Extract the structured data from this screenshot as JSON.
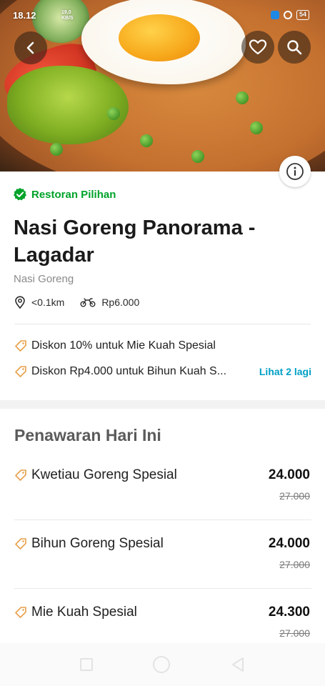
{
  "status_bar": {
    "time": "18.12",
    "net_speed": "19,0",
    "net_unit": "KB/S",
    "battery": "54"
  },
  "hero": {
    "back_icon": "back-arrow-icon",
    "favorite_icon": "heart-icon",
    "search_icon": "search-icon",
    "info_icon": "info-icon"
  },
  "restaurant": {
    "badge": "Restoran Pilihan",
    "name": "Nasi Goreng Panorama - Lagadar",
    "category": "Nasi Goreng",
    "distance": "<0.1km",
    "delivery_fee": "Rp6.000"
  },
  "promos": [
    {
      "text": "Diskon 10% untuk Mie Kuah Spesial"
    },
    {
      "text": "Diskon Rp4.000 untuk Bihun Kuah S..."
    }
  ],
  "promos_more": "Lihat 2 lagi",
  "offers": {
    "title": "Penawaran Hari Ini",
    "items": [
      {
        "name": "Kwetiau Goreng Spesial",
        "price": "24.000",
        "old_price": "27.000"
      },
      {
        "name": "Bihun Goreng Spesial",
        "price": "24.000",
        "old_price": "27.000"
      },
      {
        "name": "Mie Kuah Spesial",
        "price": "24.300",
        "old_price": "27.000"
      }
    ]
  },
  "colors": {
    "accent_green": "#00a32a",
    "link_blue": "#00a0c6",
    "tag_orange": "#e8a04a"
  }
}
